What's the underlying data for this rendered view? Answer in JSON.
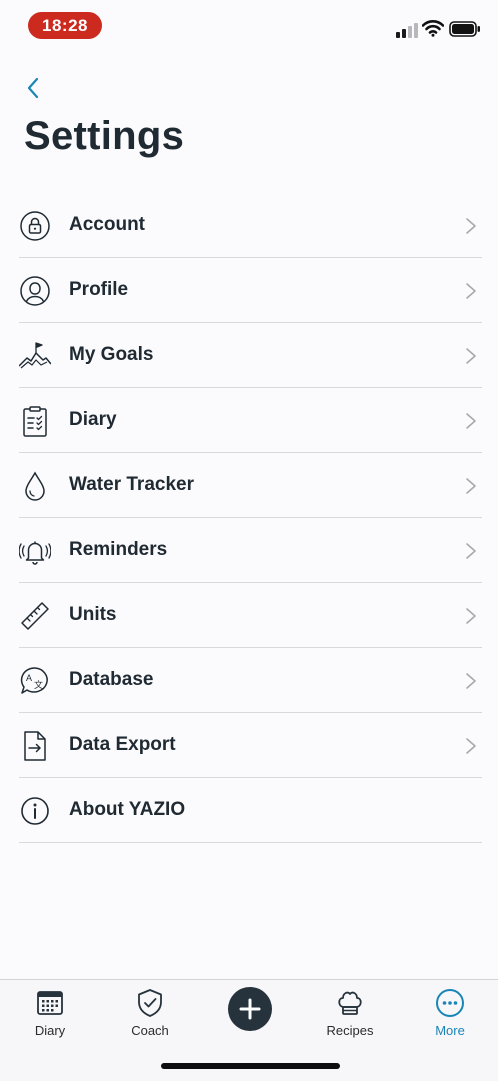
{
  "status": {
    "time": "18:28"
  },
  "header": {
    "title": "Settings"
  },
  "settings": {
    "items": [
      {
        "label": "Account",
        "icon": "lock-icon"
      },
      {
        "label": "Profile",
        "icon": "person-icon"
      },
      {
        "label": "My Goals",
        "icon": "mountain-flag-icon"
      },
      {
        "label": "Diary",
        "icon": "clipboard-icon"
      },
      {
        "label": "Water Tracker",
        "icon": "water-drop-icon"
      },
      {
        "label": "Reminders",
        "icon": "bell-icon"
      },
      {
        "label": "Units",
        "icon": "ruler-icon"
      },
      {
        "label": "Database",
        "icon": "translate-bubble-icon"
      },
      {
        "label": "Data Export",
        "icon": "file-export-icon"
      },
      {
        "label": "About YAZIO",
        "icon": "info-icon"
      }
    ]
  },
  "tabbar": {
    "items": [
      {
        "label": "Diary",
        "icon": "calendar-icon"
      },
      {
        "label": "Coach",
        "icon": "shield-check-icon"
      },
      {
        "label": "",
        "icon": "plus-icon"
      },
      {
        "label": "Recipes",
        "icon": "chef-hat-icon"
      },
      {
        "label": "More",
        "icon": "more-icon"
      }
    ],
    "active": "More"
  },
  "colors": {
    "accent": "#1a86b8",
    "text": "#1f2a33",
    "divider": "#d9d9dd",
    "status_pill": "#cc2a1e"
  }
}
